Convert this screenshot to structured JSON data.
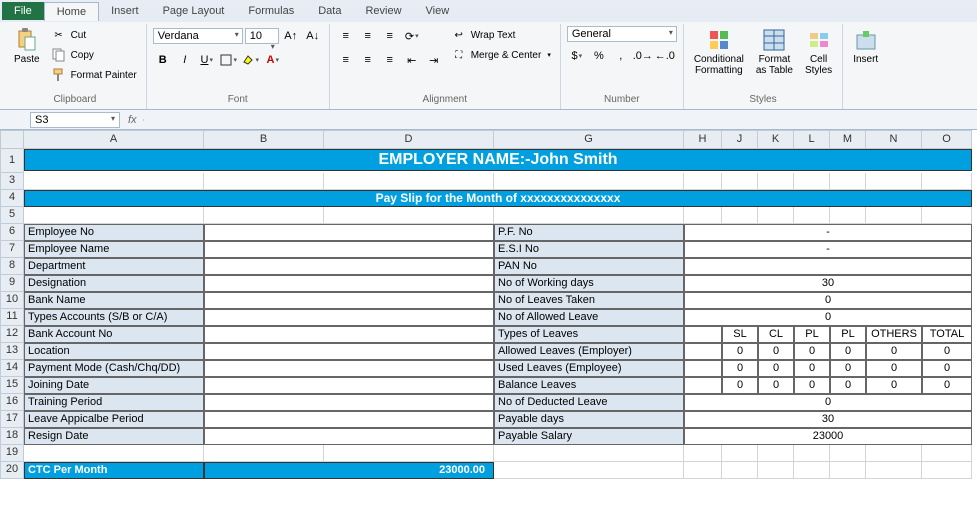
{
  "tabs": {
    "file": "File",
    "home": "Home",
    "insert": "Insert",
    "page_layout": "Page Layout",
    "formulas": "Formulas",
    "data": "Data",
    "review": "Review",
    "view": "View"
  },
  "clipboard": {
    "paste": "Paste",
    "cut": "Cut",
    "copy": "Copy",
    "format_painter": "Format Painter",
    "label": "Clipboard"
  },
  "font": {
    "name": "Verdana",
    "size": "10",
    "label": "Font"
  },
  "alignment": {
    "wrap": "Wrap Text",
    "merge": "Merge & Center",
    "label": "Alignment"
  },
  "number": {
    "format": "General",
    "label": "Number"
  },
  "styles": {
    "cond": "Conditional\nFormatting",
    "table": "Format\nas Table",
    "cell": "Cell\nStyles",
    "label": "Styles"
  },
  "cells": {
    "insert": "Insert"
  },
  "name_box": "S3",
  "fx": "fx",
  "cols": [
    "A",
    "B",
    "D",
    "G",
    "H",
    "J",
    "K",
    "L",
    "M",
    "N",
    "O"
  ],
  "sheet": {
    "title": "EMPLOYER NAME:-John Smith",
    "subtitle": "Pay Slip for the Month of xxxxxxxxxxxxxxx",
    "left_labels": [
      "Employee No",
      "Employee Name",
      "Department",
      "Designation",
      "Bank Name",
      "Types Accounts (S/B or C/A)",
      "Bank Account No",
      "Location",
      "Payment Mode (Cash/Chq/DD)",
      "Joining Date",
      "Training Period",
      "Leave Appicalbe Period",
      "Resign Date"
    ],
    "right_labels": [
      "P.F. No",
      "E.S.I No",
      "PAN No",
      "No of Working days",
      "No of Leaves Taken",
      "No of Allowed Leave",
      "Types of Leaves",
      "Allowed Leaves (Employer)",
      "Used Leaves (Employee)",
      "Balance Leaves",
      "No of Deducted Leave",
      "Payable days",
      "Payable Salary"
    ],
    "right_vals_single": [
      "-",
      "-",
      "",
      "30",
      "0",
      "0",
      "",
      "",
      "",
      "",
      "0",
      "30",
      "23000"
    ],
    "leave_headers": [
      "SL",
      "CL",
      "PL",
      "PL",
      "OTHERS",
      "TOTAL"
    ],
    "leave_rows": [
      [
        "0",
        "0",
        "0",
        "0",
        "0",
        "0"
      ],
      [
        "0",
        "0",
        "0",
        "0",
        "0",
        "0"
      ],
      [
        "0",
        "0",
        "0",
        "0",
        "0",
        "0"
      ]
    ],
    "ctc_label": "CTC Per Month",
    "ctc_value": "23000.00"
  }
}
